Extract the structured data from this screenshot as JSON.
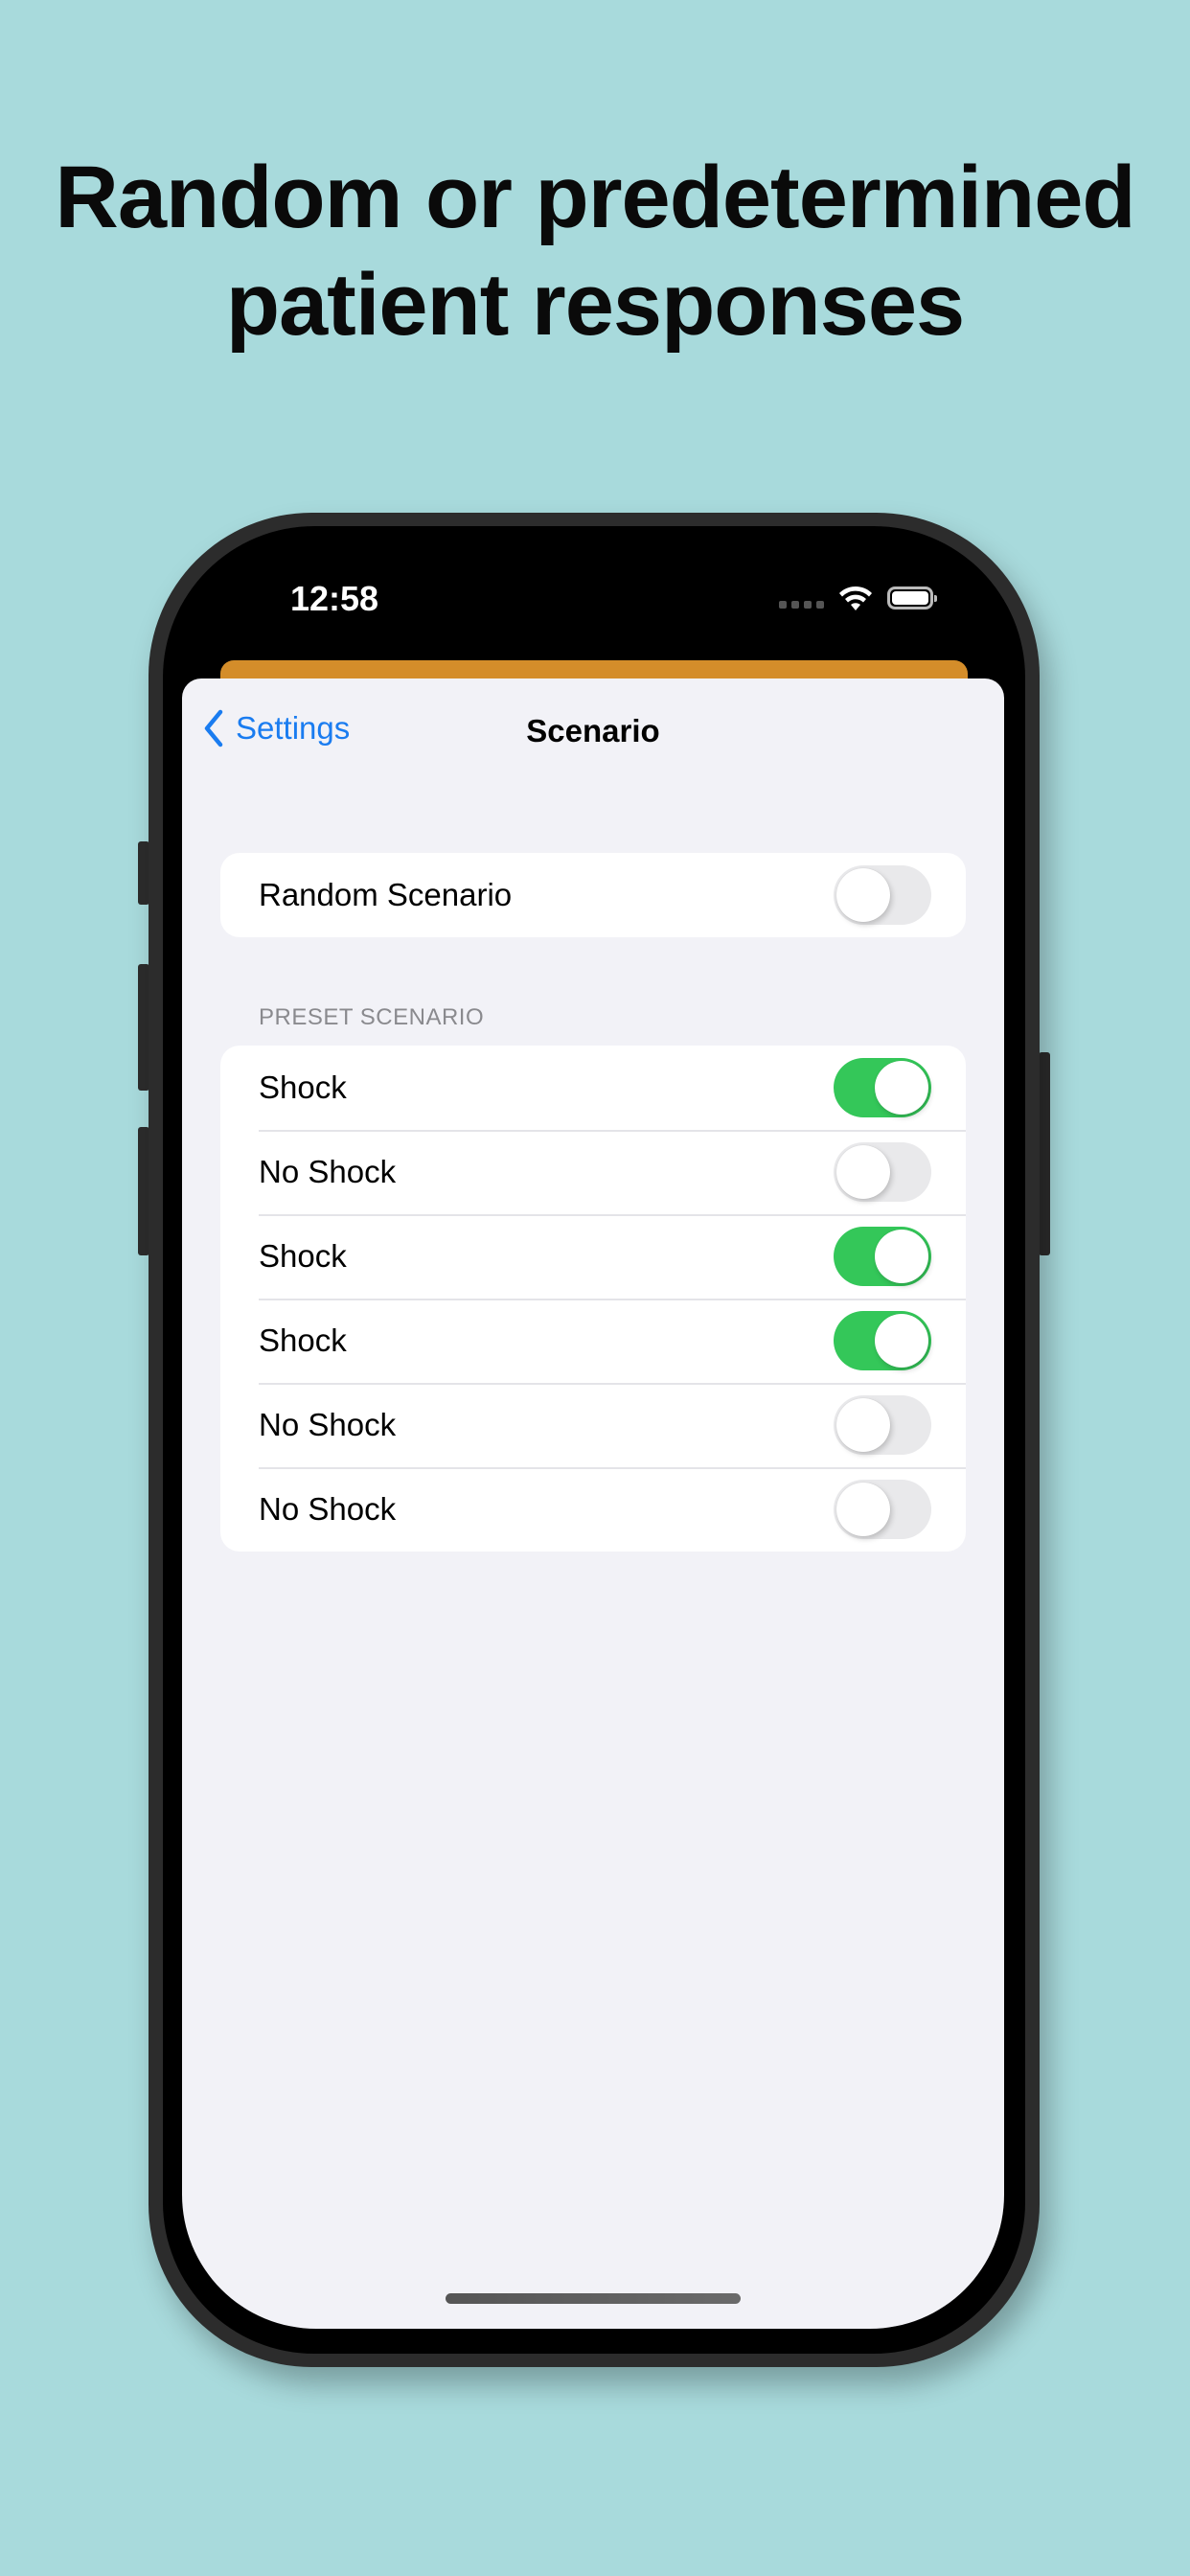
{
  "promo": {
    "headline_line1": "Random or predetermined",
    "headline_line2": "patient responses",
    "background_color": "#a8dadc"
  },
  "status_bar": {
    "time": "12:58",
    "icons": [
      "cellular-signal-icon",
      "wifi-icon",
      "battery-icon"
    ]
  },
  "nav": {
    "back_label": "Settings",
    "back_icon": "chevron-left-icon",
    "title": "Scenario"
  },
  "random_group": {
    "label": "Random Scenario",
    "on": false
  },
  "preset_section": {
    "header": "PRESET SCENARIO",
    "items": [
      {
        "label": "Shock",
        "on": true
      },
      {
        "label": "No Shock",
        "on": false
      },
      {
        "label": "Shock",
        "on": true
      },
      {
        "label": "Shock",
        "on": true
      },
      {
        "label": "No Shock",
        "on": false
      },
      {
        "label": "No Shock",
        "on": false
      }
    ]
  },
  "colors": {
    "accent_blue": "#1a7cf0",
    "toggle_on": "#34c759",
    "toggle_off": "#e9e9eb",
    "orange_card": "#d48d2a",
    "grouped_background": "#f2f2f7"
  }
}
